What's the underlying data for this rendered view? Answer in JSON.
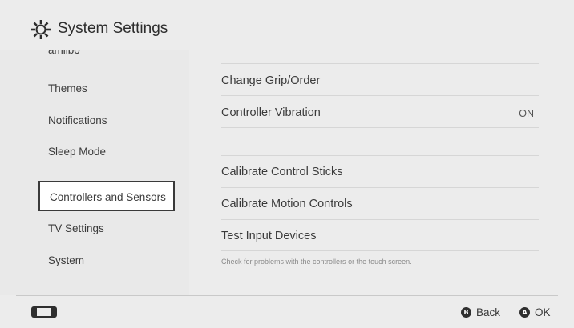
{
  "header": {
    "title": "System Settings",
    "icon": "gear-icon"
  },
  "sidebar": {
    "partial_item": "amiibo",
    "items": [
      {
        "label": "Themes"
      },
      {
        "label": "Notifications"
      },
      {
        "label": "Sleep Mode"
      },
      {
        "label": "Controllers and Sensors",
        "selected": true
      },
      {
        "label": "TV Settings"
      },
      {
        "label": "System"
      }
    ]
  },
  "main": {
    "rows": [
      {
        "label": "Change Grip/Order"
      },
      {
        "label": "Controller Vibration",
        "value": "ON"
      },
      {
        "label": "Calibrate Control Sticks"
      },
      {
        "label": "Calibrate Motion Controls"
      },
      {
        "label": "Test Input Devices",
        "hint": "Check for problems with the controllers or the touch screen."
      }
    ]
  },
  "footer": {
    "device_icon": "console-icon",
    "back": {
      "button": "B",
      "label": "Back"
    },
    "ok": {
      "button": "A",
      "label": "OK"
    }
  },
  "colors": {
    "background": "#ececec",
    "selection_border": "#3a3a3a",
    "text": "#3a3a3a"
  }
}
